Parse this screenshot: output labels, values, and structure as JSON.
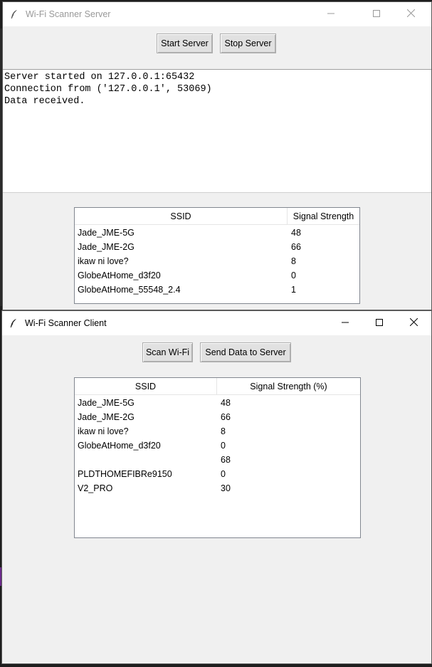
{
  "server": {
    "title": "Wi-Fi Scanner Server",
    "buttons": {
      "start": "Start Server",
      "stop": "Stop Server"
    },
    "log": [
      "Server started on 127.0.0.1:65432",
      "Connection from ('127.0.0.1', 53069)",
      "Data received."
    ],
    "table": {
      "columns": [
        "SSID",
        "Signal Strength"
      ],
      "rows": [
        [
          "Jade_JME-5G",
          "48"
        ],
        [
          "Jade_JME-2G",
          "66"
        ],
        [
          "ikaw ni love?",
          "8"
        ],
        [
          "GlobeAtHome_d3f20",
          "0"
        ],
        [
          "GlobeAtHome_55548_2.4",
          "1"
        ]
      ]
    }
  },
  "client": {
    "title": "Wi-Fi Scanner Client",
    "buttons": {
      "scan": "Scan Wi-Fi",
      "send": "Send Data to Server"
    },
    "table": {
      "columns": [
        "SSID",
        "Signal Strength (%)"
      ],
      "rows": [
        [
          "Jade_JME-5G",
          "48"
        ],
        [
          "Jade_JME-2G",
          "66"
        ],
        [
          "ikaw ni love?",
          "8"
        ],
        [
          "GlobeAtHome_d3f20",
          "0"
        ],
        [
          "",
          "68"
        ],
        [
          "PLDTHOMEFIBRe9150",
          "0"
        ],
        [
          "V2_PRO",
          "30"
        ]
      ]
    }
  },
  "icons": {
    "app": "feather-icon",
    "minimize": "minimize-icon",
    "maximize": "maximize-icon",
    "close": "close-icon"
  }
}
